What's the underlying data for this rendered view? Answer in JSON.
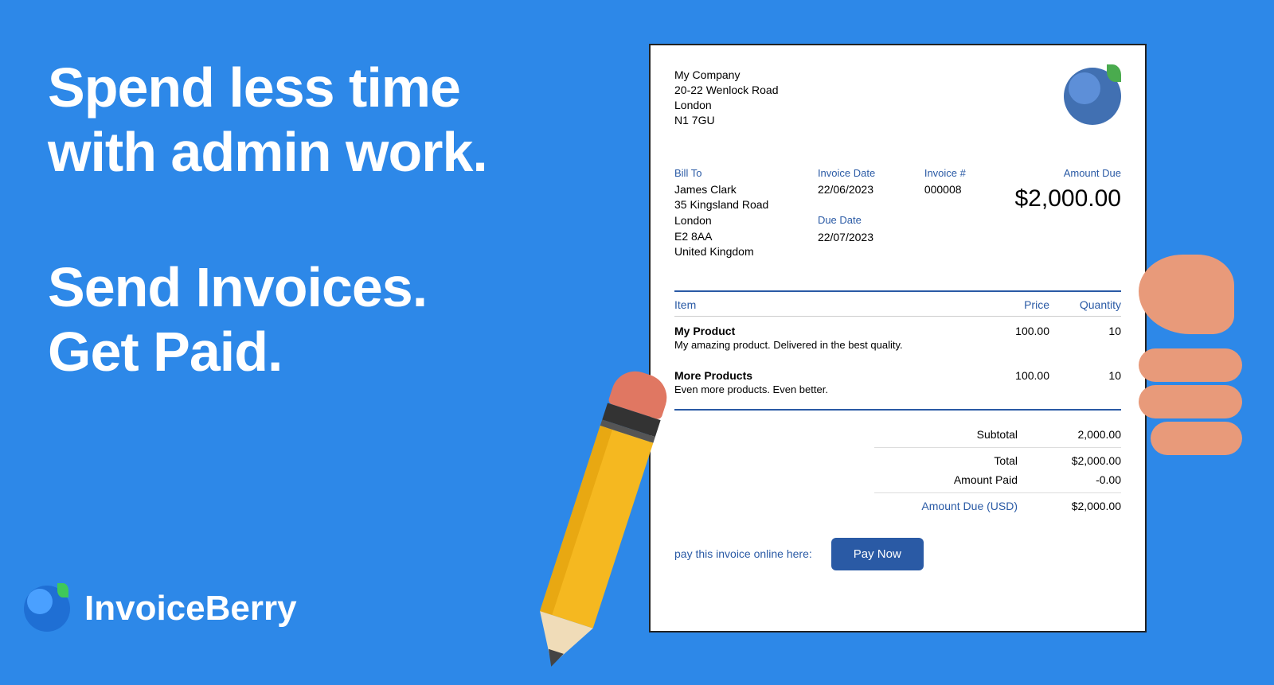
{
  "headline": {
    "line1": "Spend less time",
    "line2": "with admin work.",
    "line3": "Send Invoices.",
    "line4": "Get Paid."
  },
  "brand": {
    "name": "InvoiceBerry"
  },
  "invoice": {
    "company": {
      "name": "My Company",
      "addr1": "20-22 Wenlock Road",
      "city": "London",
      "post": "N1 7GU"
    },
    "labels": {
      "bill_to": "Bill To",
      "invoice_date": "Invoice Date",
      "due_date": "Due Date",
      "invoice_no": "Invoice #",
      "amount_due": "Amount Due",
      "item": "Item",
      "price": "Price",
      "quantity": "Quantity",
      "subtotal": "Subtotal",
      "total": "Total",
      "amount_paid": "Amount Paid",
      "amount_due_usd": "Amount Due (USD)"
    },
    "bill_to": {
      "name": "James Clark",
      "addr1": "35 Kingsland Road",
      "city": "London",
      "post": "E2 8AA",
      "country": "United Kingdom"
    },
    "invoice_date": "22/06/2023",
    "due_date": "22/07/2023",
    "invoice_no": "000008",
    "amount_due_display": "$2,000.00",
    "items": [
      {
        "name": "My Product",
        "desc": "My amazing product. Delivered in the best quality.",
        "price": "100.00",
        "qty": "10"
      },
      {
        "name": "More Products",
        "desc": "Even more products. Even better.",
        "price": "100.00",
        "qty": "10"
      }
    ],
    "totals": {
      "subtotal": "2,000.00",
      "total": "$2,000.00",
      "amount_paid": "-0.00",
      "amount_due": "$2,000.00"
    },
    "pay": {
      "text": "pay this invoice online here:",
      "button": "Pay Now"
    }
  }
}
